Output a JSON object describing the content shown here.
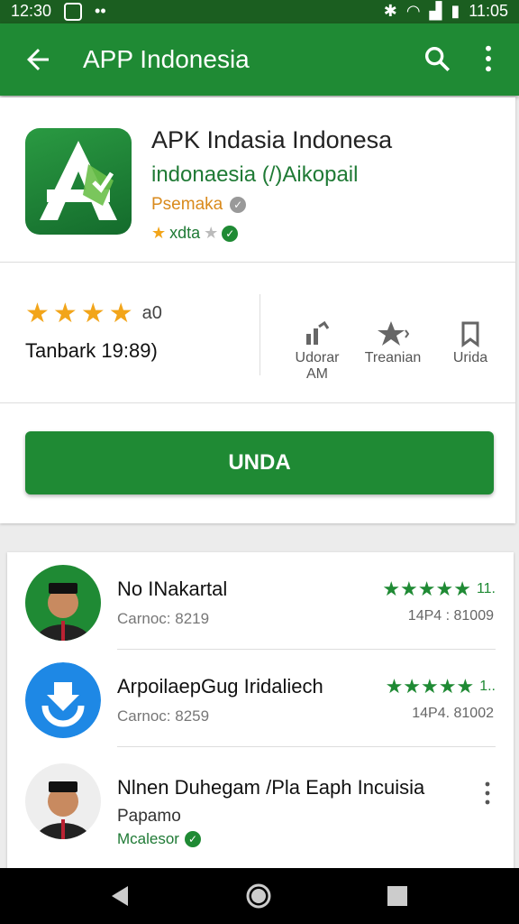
{
  "status": {
    "time_left": "12:30",
    "time_right": "11:05"
  },
  "toolbar": {
    "title": "APP Indonesia"
  },
  "app": {
    "title": "APK Indasia Indonesa",
    "subtitle": "indonaesia (/)Aikopail",
    "developer": "Psemaka",
    "rating_text": "xdta"
  },
  "stats": {
    "rating_count": "a0",
    "downloads_label": "Tanbark",
    "downloads_value": "19:89)",
    "actions": [
      {
        "label1": "Udorar",
        "label2": "AM"
      },
      {
        "label1": "Treanian",
        "label2": ""
      },
      {
        "label1": "Urida",
        "label2": ""
      }
    ]
  },
  "install": {
    "label": "UNDA"
  },
  "list": [
    {
      "name": "No INakartal",
      "meta": "Carnoc: 8219",
      "rating": "11.",
      "right_meta": "14P4 : 81009"
    },
    {
      "name": "ArpoilaepGug Iridaliech",
      "meta": "Carnoc: 8259",
      "rating": "1..",
      "right_meta": "14P4. 81002"
    },
    {
      "name": "Nlnen Duhegam /Pla Eaph Incuisia",
      "sub": "Papamo",
      "maker": "Mcalesor"
    }
  ],
  "colors": {
    "primary": "#1f8a34",
    "primary_dark": "#1b5e20",
    "star": "#f2a51a"
  }
}
